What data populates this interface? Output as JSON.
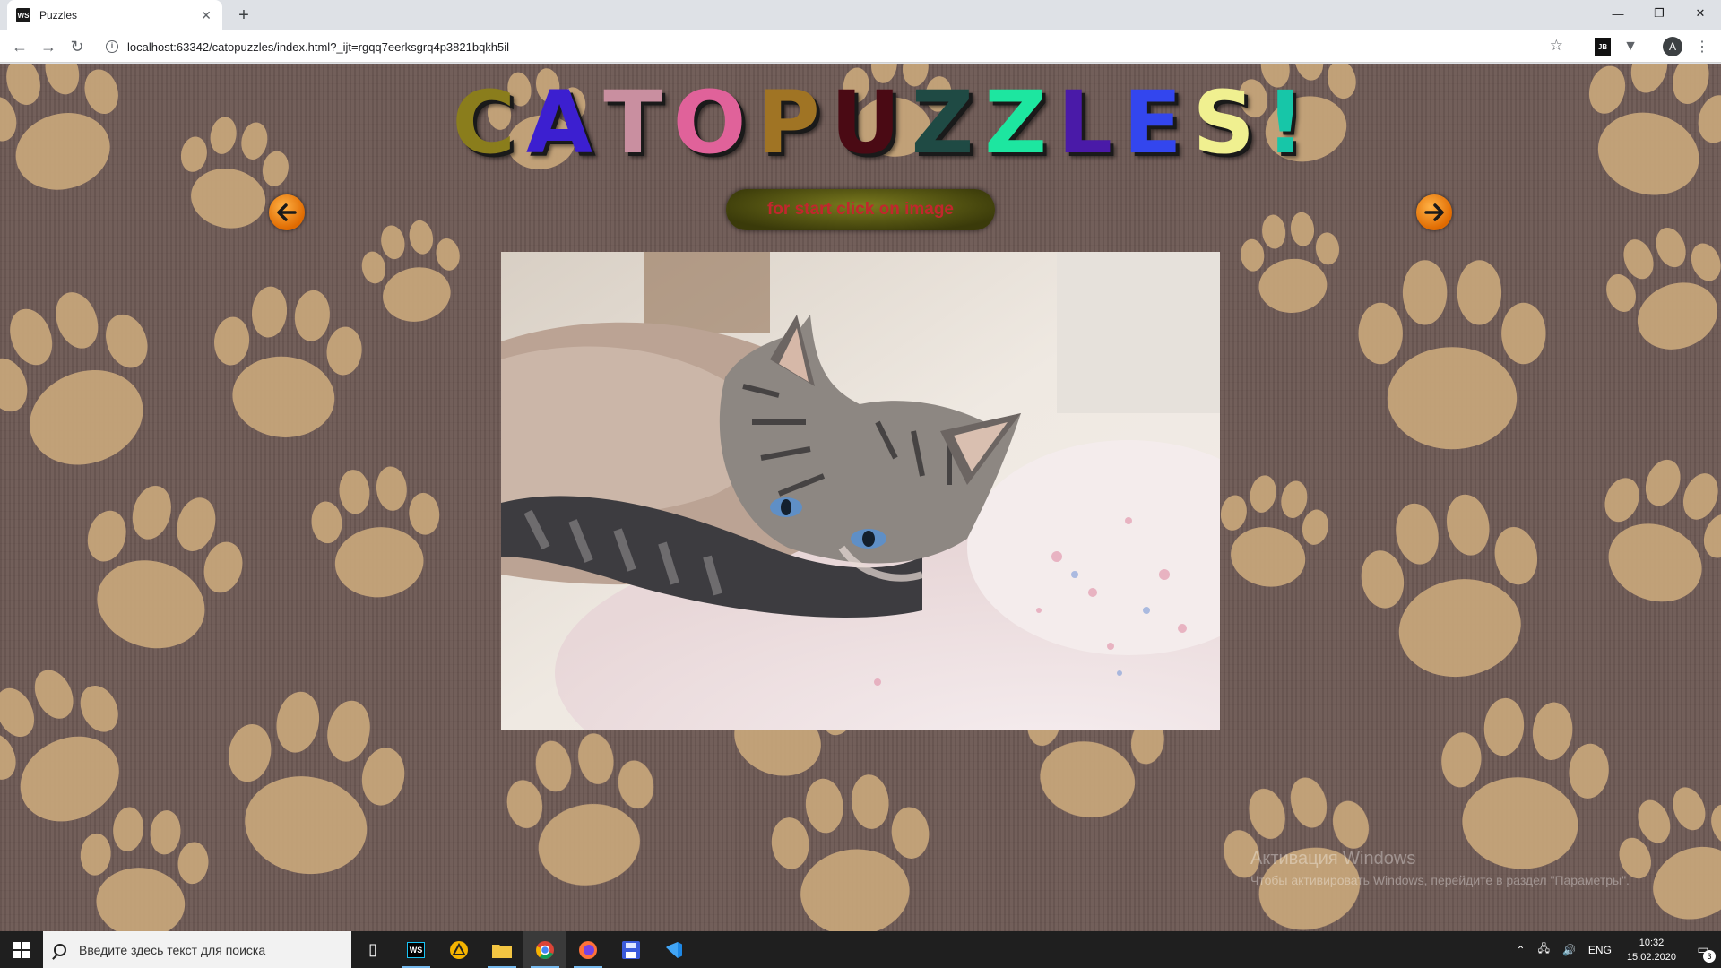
{
  "browser": {
    "tab_title": "Puzzles",
    "tab_favicon_text": "WS",
    "url": "localhost:63342/catopuzzles/index.html?_ijt=rgqq7eerksgrq4p3821bqkh5il",
    "profile_initial": "A",
    "extension_text": "JB"
  },
  "page": {
    "title_letters": [
      {
        "char": "C",
        "color": "#8a7d1c"
      },
      {
        "char": "A",
        "color": "#3c1fd0"
      },
      {
        "char": "T",
        "color": "#c98fa0"
      },
      {
        "char": "O",
        "color": "#e0629a"
      },
      {
        "char": "P",
        "color": "#a07424"
      },
      {
        "char": "U",
        "color": "#4a0a14"
      },
      {
        "char": "Z",
        "color": "#1f4a44"
      },
      {
        "char": "Z",
        "color": "#1de6a0"
      },
      {
        "char": "L",
        "color": "#4a1aa8"
      },
      {
        "char": "E",
        "color": "#3346ee"
      },
      {
        "char": "S",
        "color": "#f0f090"
      },
      {
        "char": "!",
        "color": "#17c6a8"
      }
    ],
    "start_hint": "for start click on image",
    "watermark_title": "Активация Windows",
    "watermark_sub": "Чтобы активировать Windows, перейдите в раздел \"Параметры\"."
  },
  "taskbar": {
    "search_placeholder": "Введите здесь текст для поиска",
    "lang": "ENG",
    "time": "10:32",
    "date": "15.02.2020",
    "notification_count": "3"
  },
  "colors": {
    "background": "#6e5a55",
    "paw": "#c9a77c",
    "arrow": "#f08a1e",
    "hint_text": "#c1272d"
  }
}
